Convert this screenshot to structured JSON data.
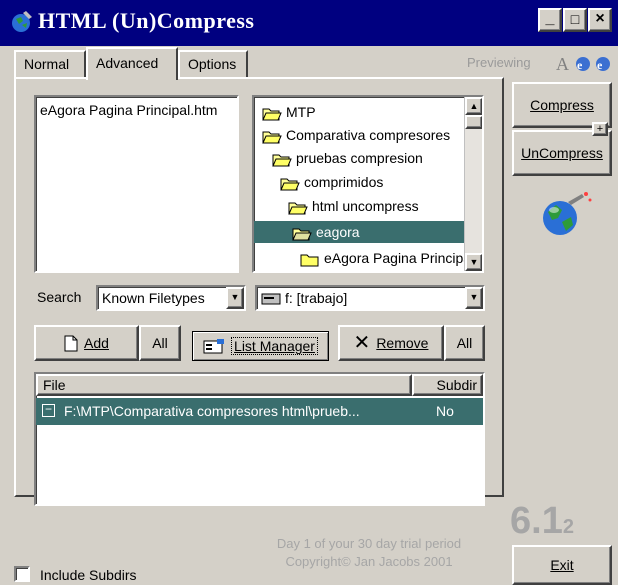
{
  "window": {
    "title": "HTML (Un)Compress",
    "controls": [
      "_",
      "□",
      "×"
    ]
  },
  "tabs": [
    {
      "label": "Normal",
      "active": false
    },
    {
      "label": "Advanced",
      "active": true
    },
    {
      "label": "Options",
      "active": false
    }
  ],
  "preview": {
    "label": "Previewing"
  },
  "file_list": {
    "items": [
      "eAgora  Pagina Principal.htm"
    ]
  },
  "tree": {
    "items": [
      {
        "label": "MTP",
        "level": 0,
        "selected": false
      },
      {
        "label": "Comparativa compresores",
        "level": 0,
        "selected": false
      },
      {
        "label": "pruebas compresion",
        "level": 1,
        "selected": false
      },
      {
        "label": "comprimidos",
        "level": 1,
        "selected": false
      },
      {
        "label": "html uncompress",
        "level": 2,
        "selected": false
      },
      {
        "label": "eagora",
        "level": 2,
        "selected": true
      },
      {
        "label": "eAgora  Pagina Principal",
        "level": 3,
        "selected": false
      }
    ]
  },
  "search": {
    "label": "Search",
    "value": "Known Filetypes"
  },
  "drive": {
    "value": "f: [trabajo]"
  },
  "buttons": {
    "add": "Add",
    "add_all": "All",
    "list_manager": "List Manager",
    "remove": "Remove",
    "remove_all": "All",
    "compress": "Compress",
    "uncompress": "UnCompress",
    "exit": "Exit"
  },
  "list_view": {
    "headers": {
      "file": "File",
      "subdir": "Subdir"
    },
    "rows": [
      {
        "expander": "−",
        "file": "F:\\MTP\\Comparativa compresores html\\prueb...",
        "subdir": "No"
      }
    ]
  },
  "version": {
    "major": "6.1",
    "minor": "2"
  },
  "trial": {
    "line1": "Day 1 of your 30 day trial period",
    "line2": "Copyright© Jan Jacobs 2001"
  },
  "include_subdirs": {
    "label": "Include Subdirs",
    "checked": false
  }
}
